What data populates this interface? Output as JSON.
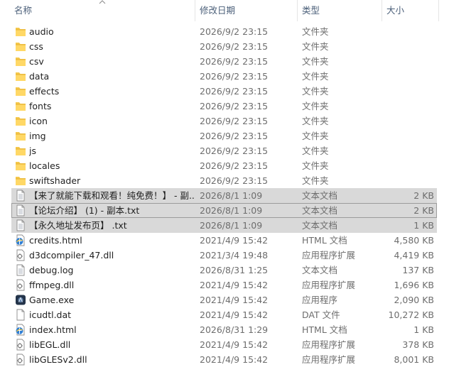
{
  "columns": {
    "name": "名称",
    "date": "修改日期",
    "type": "类型",
    "size": "大小"
  },
  "files": [
    {
      "name": "audio",
      "date": "2026/9/2 23:15",
      "type": "文件夹",
      "size": "",
      "icon": "folder-icon"
    },
    {
      "name": "css",
      "date": "2026/9/2 23:15",
      "type": "文件夹",
      "size": "",
      "icon": "folder-icon"
    },
    {
      "name": "csv",
      "date": "2026/9/2 23:15",
      "type": "文件夹",
      "size": "",
      "icon": "folder-icon"
    },
    {
      "name": "data",
      "date": "2026/9/2 23:15",
      "type": "文件夹",
      "size": "",
      "icon": "folder-icon"
    },
    {
      "name": "effects",
      "date": "2026/9/2 23:15",
      "type": "文件夹",
      "size": "",
      "icon": "folder-icon"
    },
    {
      "name": "fonts",
      "date": "2026/9/2 23:15",
      "type": "文件夹",
      "size": "",
      "icon": "folder-icon"
    },
    {
      "name": "icon",
      "date": "2026/9/2 23:15",
      "type": "文件夹",
      "size": "",
      "icon": "folder-icon"
    },
    {
      "name": "img",
      "date": "2026/9/2 23:15",
      "type": "文件夹",
      "size": "",
      "icon": "folder-icon"
    },
    {
      "name": "js",
      "date": "2026/9/2 23:15",
      "type": "文件夹",
      "size": "",
      "icon": "folder-icon"
    },
    {
      "name": "locales",
      "date": "2026/9/2 23:15",
      "type": "文件夹",
      "size": "",
      "icon": "folder-icon"
    },
    {
      "name": "swiftshader",
      "date": "2026/9/2 23:15",
      "type": "文件夹",
      "size": "",
      "icon": "folder-icon"
    },
    {
      "name": "【来了就能下载和观看！纯免费！】 - 副...",
      "date": "2026/8/1 1:09",
      "type": "文本文档",
      "size": "2 KB",
      "icon": "text-file-icon",
      "selected": true
    },
    {
      "name": "【论坛介绍】 (1) - 副本.txt",
      "date": "2026/8/1 1:09",
      "type": "文本文档",
      "size": "2 KB",
      "icon": "text-file-icon",
      "selected": true
    },
    {
      "name": "【永久地址发布页】 .txt",
      "date": "2026/8/1 1:09",
      "type": "文本文档",
      "size": "1 KB",
      "icon": "text-file-icon",
      "selected": true
    },
    {
      "name": "credits.html",
      "date": "2021/4/9 15:42",
      "type": "HTML 文档",
      "size": "4,580 KB",
      "icon": "html-file-icon"
    },
    {
      "name": "d3dcompiler_47.dll",
      "date": "2021/3/4 19:48",
      "type": "应用程序扩展",
      "size": "4,419 KB",
      "icon": "dll-file-icon"
    },
    {
      "name": "debug.log",
      "date": "2026/8/31 1:25",
      "type": "文本文档",
      "size": "137 KB",
      "icon": "text-file-icon"
    },
    {
      "name": "ffmpeg.dll",
      "date": "2021/4/9 15:42",
      "type": "应用程序扩展",
      "size": "1,696 KB",
      "icon": "dll-file-icon"
    },
    {
      "name": "Game.exe",
      "date": "2021/4/9 15:42",
      "type": "应用程序",
      "size": "2,090 KB",
      "icon": "exe-file-icon"
    },
    {
      "name": "icudtl.dat",
      "date": "2021/4/9 15:42",
      "type": "DAT 文件",
      "size": "10,272 KB",
      "icon": "blank-file-icon"
    },
    {
      "name": "index.html",
      "date": "2026/8/31 1:29",
      "type": "HTML 文档",
      "size": "1 KB",
      "icon": "html-file-icon"
    },
    {
      "name": "libEGL.dll",
      "date": "2021/4/9 15:42",
      "type": "应用程序扩展",
      "size": "378 KB",
      "icon": "dll-file-icon"
    },
    {
      "name": "libGLESv2.dll",
      "date": "2021/4/9 15:42",
      "type": "应用程序扩展",
      "size": "8,001 KB",
      "icon": "dll-file-icon"
    }
  ]
}
